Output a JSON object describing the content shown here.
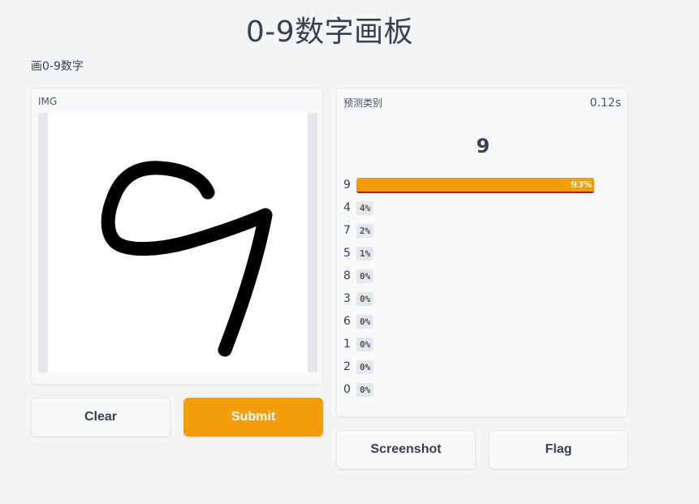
{
  "page": {
    "title": "0-9数字画板",
    "description": "画0-9数字"
  },
  "input": {
    "label": "IMG",
    "drawn_digit_icon": "handwritten-nine-stroke"
  },
  "buttons": {
    "clear": "Clear",
    "submit": "Submit",
    "screenshot": "Screenshot",
    "flag": "Flag"
  },
  "output": {
    "label": "预测类别",
    "elapsed": "0.12s",
    "top_prediction": "9",
    "confidences": [
      {
        "label": "9",
        "pct": "93%",
        "value": 0.93
      },
      {
        "label": "4",
        "pct": "4%",
        "value": 0.04
      },
      {
        "label": "7",
        "pct": "2%",
        "value": 0.02
      },
      {
        "label": "5",
        "pct": "1%",
        "value": 0.01
      },
      {
        "label": "8",
        "pct": "0%",
        "value": 0.0
      },
      {
        "label": "3",
        "pct": "0%",
        "value": 0.0
      },
      {
        "label": "6",
        "pct": "0%",
        "value": 0.0
      },
      {
        "label": "1",
        "pct": "0%",
        "value": 0.0
      },
      {
        "label": "2",
        "pct": "0%",
        "value": 0.0
      },
      {
        "label": "0",
        "pct": "0%",
        "value": 0.0
      }
    ]
  },
  "colors": {
    "accent": "#f59e0b",
    "bar_underline": "#b91c1c",
    "panel_bg": "#f8f9fb",
    "page_bg": "#f4f5f7"
  }
}
